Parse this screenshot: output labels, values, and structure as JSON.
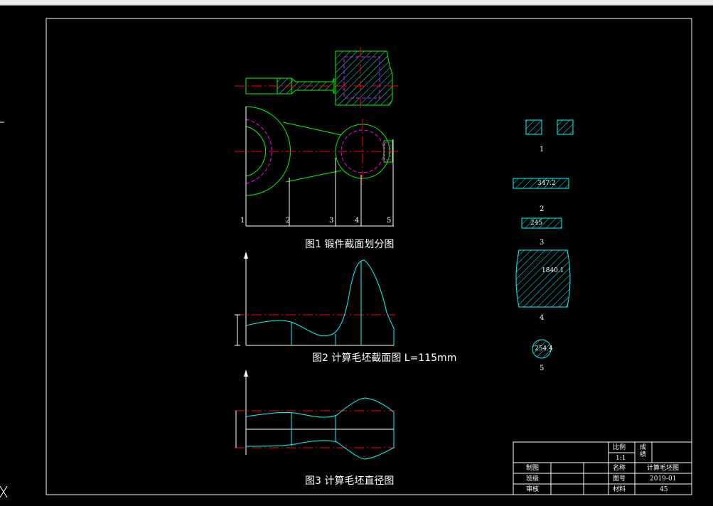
{
  "captions": {
    "fig1": "图1 锻件截面划分图",
    "fig2": "图2 计算毛坯截面图 L=115mm",
    "fig3": "图3 计算毛坯直径图"
  },
  "fig1_station_labels": [
    "1",
    "2",
    "3",
    "4",
    "5"
  ],
  "sections": [
    {
      "number": "1",
      "value": "",
      "shape": "pair-of-squares"
    },
    {
      "number": "2",
      "value": "347.2",
      "shape": "rectangle"
    },
    {
      "number": "3",
      "value": "245",
      "shape": "rectangle"
    },
    {
      "number": "4",
      "value": "1840.1",
      "shape": "barrel"
    },
    {
      "number": "5",
      "value": "254.4",
      "shape": "circle"
    }
  ],
  "title_block": {
    "scale_label": "比例",
    "scale_value": "1:1",
    "unit_label": "成绩",
    "rows": [
      {
        "left": "制图",
        "right_label": "名称",
        "right_value": "计算毛坯图"
      },
      {
        "left": "班级",
        "right_label": "图号",
        "right_value": "2019-01"
      },
      {
        "left": "审核",
        "right_label": "材料",
        "right_value": "45"
      }
    ]
  },
  "colors": {
    "frame": "#ffffff",
    "outline": "#00ff00",
    "centerline": "#ff0000",
    "hidden": "#ff00ff",
    "blank": "#00ffff",
    "hatch": "#00ffff"
  }
}
